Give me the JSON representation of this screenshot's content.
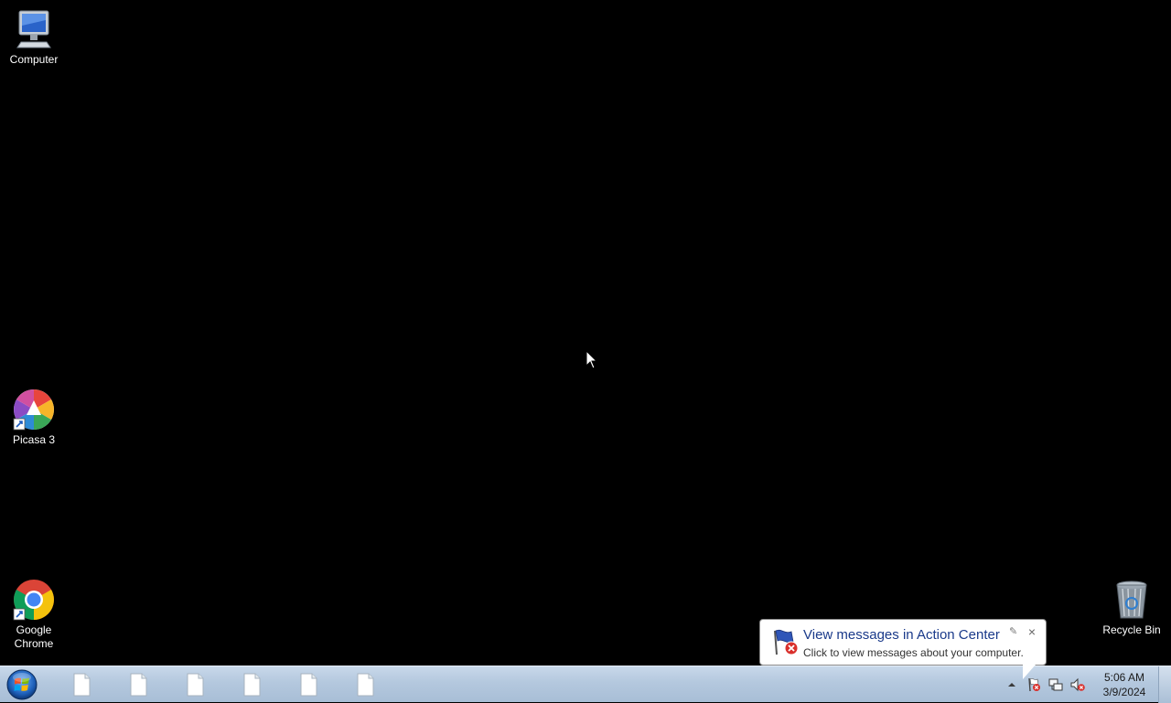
{
  "desktop": {
    "background_color": "#000000",
    "icons": [
      {
        "label": "Computer",
        "icon": "computer-icon"
      },
      {
        "label": "Picasa 3",
        "icon": "picasa-icon"
      },
      {
        "label": "Google Chrome",
        "icon": "chrome-icon"
      },
      {
        "label": "Recycle Bin",
        "icon": "recycle-bin-icon"
      }
    ]
  },
  "taskbar": {
    "start_icon": "windows-start-orb-icon",
    "buttons": [
      {
        "icon": "document-icon"
      },
      {
        "icon": "document-icon"
      },
      {
        "icon": "document-icon"
      },
      {
        "icon": "document-icon"
      },
      {
        "icon": "document-icon"
      },
      {
        "icon": "document-icon"
      }
    ],
    "tray": {
      "overflow_icon": "chevron-up-icon",
      "icons": [
        "action-center-flag-icon",
        "network-icon",
        "volume-muted-icon"
      ]
    },
    "clock": {
      "time": "5:06 AM",
      "date": "3/9/2024"
    }
  },
  "balloon": {
    "title": "View messages in Action Center",
    "text": "Click to view messages about your computer.",
    "options_glyph": "✎",
    "close_glyph": "×"
  },
  "colors": {
    "taskbar": "#b4c8de",
    "balloon_title": "#1a3a8a",
    "error_red": "#d9302c"
  }
}
